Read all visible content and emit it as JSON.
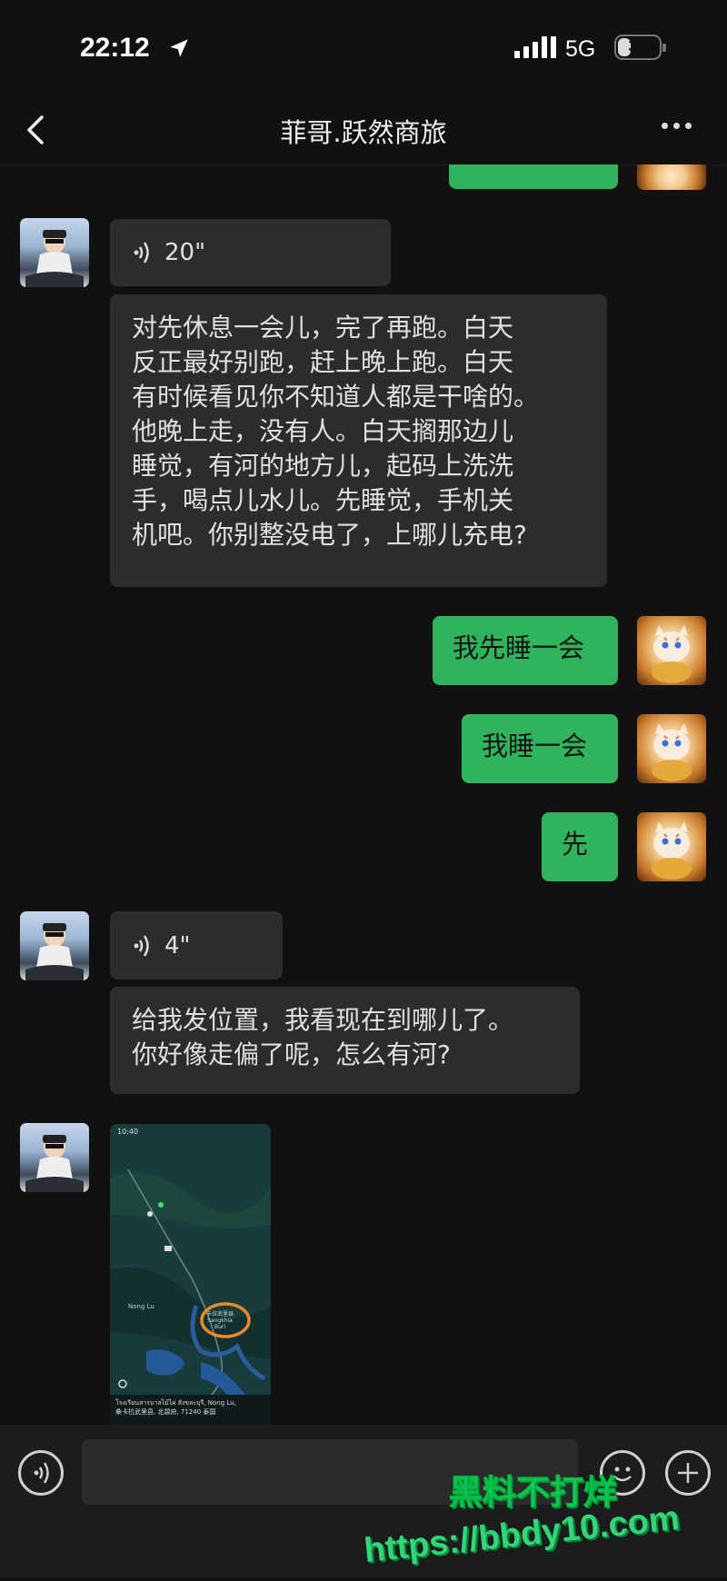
{
  "status": {
    "time": "22:12",
    "network": "5G",
    "battery": "32"
  },
  "nav": {
    "title": "菲哥.跃然商旅"
  },
  "messages": {
    "voice1": {
      "duration": "20\""
    },
    "text1": {
      "lines": [
        "对先休息一会儿，完了再跑。白天",
        "反正最好别跑，赶上晚上跑。白天",
        "有时候看见你不知道人都是干啥的。",
        "他晚上走，没有人。白天搁那边儿",
        "睡觉，有河的地方儿，起码上洗洗",
        "手，喝点儿水儿。先睡觉，手机关",
        "机吧。你别整没电了，上哪儿充电?"
      ]
    },
    "me1": {
      "text": "我先睡一会"
    },
    "me2": {
      "text": "我睡一会"
    },
    "me3": {
      "text": "先"
    },
    "voice2": {
      "duration": "4\""
    },
    "text2": {
      "lines": [
        "给我发位置，我看现在到哪儿了。",
        "你好像走偏了呢，怎么有河?"
      ]
    },
    "map": {
      "phone_time": "10:40",
      "place_label": "Nong Lu",
      "circle_label_1": "卡拉武里县",
      "circle_label_2": "Sangkhla",
      "circle_label_3": "Buri",
      "caption_line1": "โรงเรียนสารบาลไม้ไผ่ สังขละบุรี, Nong Lu,",
      "caption_line2": "桑卡拉武里县, 北碧府, 71240 泰国"
    }
  },
  "watermark": {
    "line1": "黑料不打烊",
    "line2": "https://bbdy10.com"
  },
  "icons": [
    "location-arrow-icon",
    "signal-icon",
    "battery-icon",
    "back-icon",
    "more-icon",
    "voice-wave-icon",
    "voice-input-icon",
    "emoji-icon",
    "plus-icon"
  ]
}
